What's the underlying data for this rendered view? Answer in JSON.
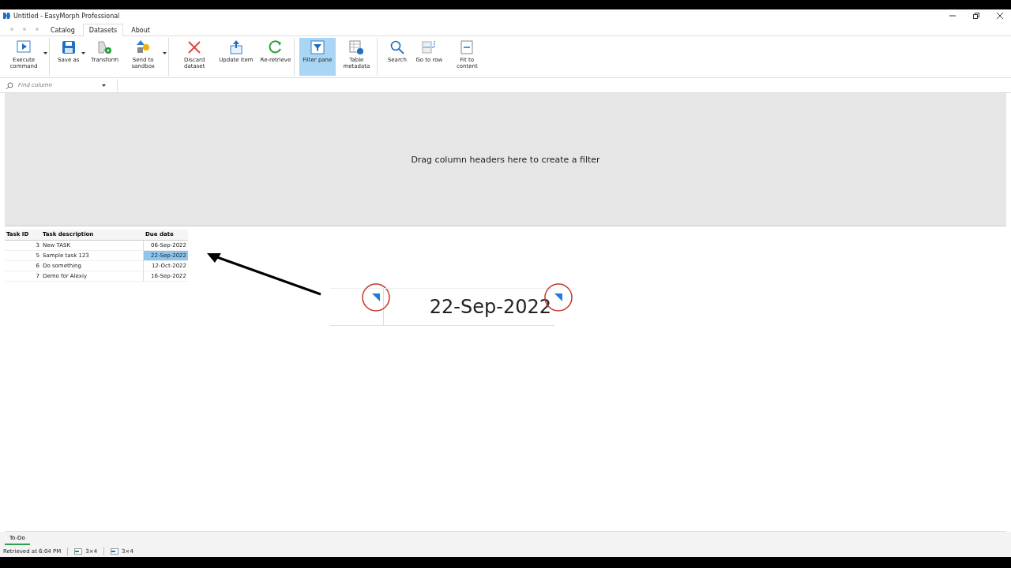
{
  "window": {
    "title": "Untitled - EasyMorph Professional"
  },
  "menu_tabs": [
    {
      "label": "Catalog",
      "selected": false
    },
    {
      "label": "Datasets",
      "selected": true
    },
    {
      "label": "About",
      "selected": false
    }
  ],
  "toolbar": [
    {
      "kind": "play",
      "label": "Execute command",
      "dropdown": true,
      "active": false,
      "group_end": true
    },
    {
      "kind": "save",
      "label": "Save as",
      "dropdown": true,
      "active": false,
      "group_end": false
    },
    {
      "kind": "transform",
      "label": "Transform",
      "dropdown": false,
      "active": false,
      "group_end": false
    },
    {
      "kind": "send",
      "label": "Send to sandbox",
      "dropdown": true,
      "active": false,
      "group_end": true
    },
    {
      "kind": "discard",
      "label": "Discard dataset",
      "dropdown": false,
      "active": false,
      "group_end": false
    },
    {
      "kind": "update",
      "label": "Update item",
      "dropdown": false,
      "active": false,
      "group_end": false
    },
    {
      "kind": "refresh",
      "label": "Re-retrieve",
      "dropdown": false,
      "active": false,
      "group_end": true
    },
    {
      "kind": "filter",
      "label": "Filter pane",
      "dropdown": false,
      "active": true,
      "group_end": false
    },
    {
      "kind": "metadata",
      "label": "Table metadata",
      "dropdown": false,
      "active": false,
      "group_end": true
    },
    {
      "kind": "search",
      "label": "Search",
      "dropdown": false,
      "active": false,
      "group_end": false
    },
    {
      "kind": "goto",
      "label": "Go to row",
      "dropdown": false,
      "active": false,
      "group_end": false
    },
    {
      "kind": "fit",
      "label": "Fit to content",
      "dropdown": false,
      "active": false,
      "group_end": false
    }
  ],
  "find_column": {
    "placeholder": "Find column"
  },
  "filter_pane": {
    "hint": "Drag column headers here to create a filter"
  },
  "table": {
    "columns": [
      "Task ID",
      "Task description",
      "Due date"
    ],
    "rows": [
      {
        "task_id": "3",
        "description": "New TASK",
        "due_date": "06-Sep-2022",
        "selected": false
      },
      {
        "task_id": "5",
        "description": "Sample task 123",
        "due_date": "22-Sep-2022",
        "selected": true
      },
      {
        "task_id": "6",
        "description": "Do something",
        "due_date": "12-Oct-2022",
        "selected": false
      },
      {
        "task_id": "7",
        "description": "Demo for Alexiy",
        "due_date": "16-Sep-2022",
        "selected": false
      }
    ]
  },
  "callout": {
    "value": "22-Sep-2022"
  },
  "sheet_tabs": [
    {
      "label": "To-Do",
      "selected": true
    }
  ],
  "status_bar": {
    "message": "Retrieved at 6:04 PM",
    "input_size": "3×4",
    "output_size": "3×4"
  }
}
